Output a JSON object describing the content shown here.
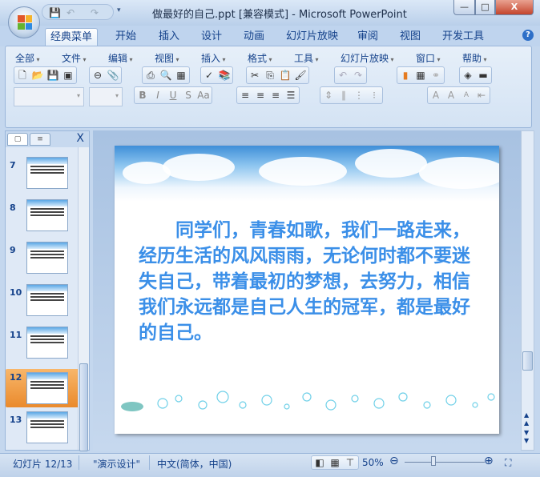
{
  "window": {
    "title": "做最好的自己.ppt [兼容模式] - Microsoft PowerPoint",
    "minimize": "—",
    "maximize": "□",
    "close": "X"
  },
  "ribbon_tabs": [
    "经典菜单",
    "开始",
    "插入",
    "设计",
    "动画",
    "幻灯片放映",
    "审阅",
    "视图",
    "开发工具"
  ],
  "classic_menu": [
    "全部",
    "文件",
    "编辑",
    "视图",
    "插入",
    "格式",
    "工具",
    "幻灯片放映",
    "窗口",
    "帮助"
  ],
  "slides_panel": {
    "close": "X",
    "slides": [
      {
        "number": "7"
      },
      {
        "number": "8"
      },
      {
        "number": "9"
      },
      {
        "number": "10"
      },
      {
        "number": "11"
      },
      {
        "number": "12",
        "selected": true
      },
      {
        "number": "13"
      }
    ]
  },
  "slide": {
    "text": "同学们，青春如歌，我们一路走来，经历生活的风风雨雨，无论何时都不要迷失自己，带着最初的梦想，去努力，相信我们永远都是自己人生的冠军，都是最好的自己。"
  },
  "status": {
    "slide_info": "幻灯片 12/13",
    "theme": "\"演示设计\"",
    "language": "中文(简体，中国)",
    "zoom": "50%",
    "zoom_percent": 50
  },
  "colors": {
    "accent_text": "#3b8fe8",
    "selected_thumb": "#ea8a2c"
  }
}
